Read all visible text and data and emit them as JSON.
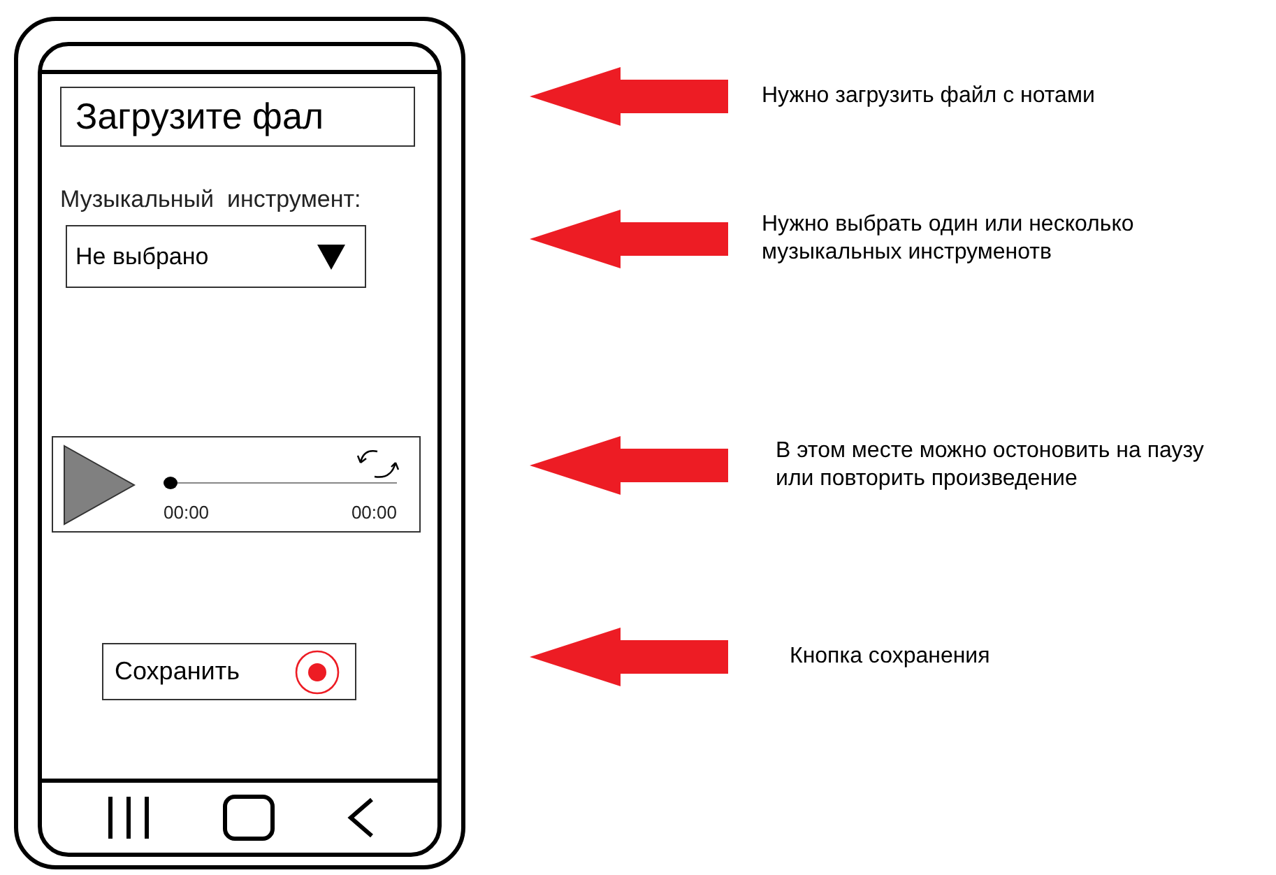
{
  "phone": {
    "file_field": {
      "value": "Загрузите фал"
    },
    "instrument_label": "Музыкальный  инструмент:",
    "instrument_select": {
      "value": "Не выбрано"
    },
    "player": {
      "level": 0,
      "elapsed": "00:00",
      "total": "00:00"
    },
    "save_button": {
      "label": "Сохранить"
    }
  },
  "annotations": [
    {
      "text": "Нужно загрузить файл с нотами"
    },
    {
      "text": "Нужно выбрать один или несколько\nмузыкальных инструменотв"
    },
    {
      "text": "В этом месте можно остоновить на паузу\nили повторить произведение"
    },
    {
      "text": "Кнопка сохранения"
    }
  ]
}
